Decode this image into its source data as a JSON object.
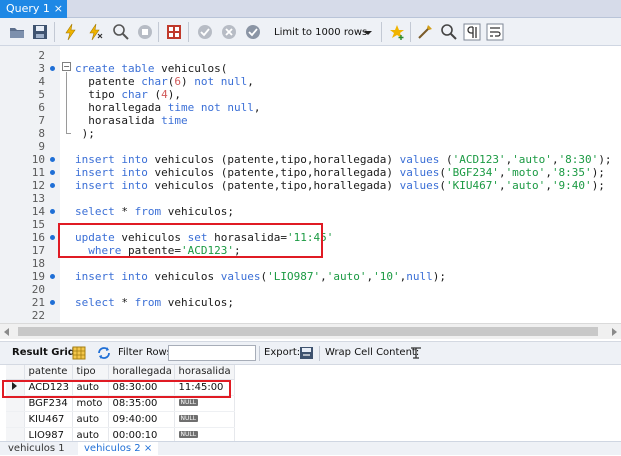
{
  "tab": {
    "title": "Query 1",
    "close": "×"
  },
  "toolbar": {
    "limit_label": "Limit to 1000 rows"
  },
  "editor": {
    "lines": [
      {
        "n": "2",
        "dot": false,
        "code": ""
      },
      {
        "n": "3",
        "dot": true,
        "code": "create table vehiculos("
      },
      {
        "n": "4",
        "dot": false,
        "code": "  patente char(6) not null,"
      },
      {
        "n": "5",
        "dot": false,
        "code": "  tipo char (4),"
      },
      {
        "n": "6",
        "dot": false,
        "code": "  horallegada time not null,"
      },
      {
        "n": "7",
        "dot": false,
        "code": "  horasalida time"
      },
      {
        "n": "8",
        "dot": false,
        "code": " );"
      },
      {
        "n": "9",
        "dot": false,
        "code": ""
      },
      {
        "n": "10",
        "dot": true,
        "code": "insert into vehiculos (patente,tipo,horallegada) values ('ACD123','auto','8:30');"
      },
      {
        "n": "11",
        "dot": true,
        "code": "insert into vehiculos (patente,tipo,horallegada) values('BGF234','moto','8:35');"
      },
      {
        "n": "12",
        "dot": true,
        "code": "insert into vehiculos (patente,tipo,horallegada) values('KIU467','auto','9:40');"
      },
      {
        "n": "13",
        "dot": false,
        "code": ""
      },
      {
        "n": "14",
        "dot": true,
        "code": "select * from vehiculos;"
      },
      {
        "n": "15",
        "dot": false,
        "code": ""
      },
      {
        "n": "16",
        "dot": true,
        "code": "update vehiculos set horasalida='11:45'"
      },
      {
        "n": "17",
        "dot": false,
        "code": "  where patente='ACD123';"
      },
      {
        "n": "18",
        "dot": false,
        "code": ""
      },
      {
        "n": "19",
        "dot": true,
        "code": "insert into vehiculos values('LIO987','auto','10',null);"
      },
      {
        "n": "20",
        "dot": false,
        "code": ""
      },
      {
        "n": "21",
        "dot": true,
        "code": "select * from vehiculos;"
      },
      {
        "n": "22",
        "dot": false,
        "code": ""
      }
    ]
  },
  "result_toolbar": {
    "result_grid": "Result Grid",
    "filter_rows": "Filter Rows:",
    "filter_value": "",
    "export": "Export:",
    "wrap": "Wrap Cell Content:"
  },
  "grid": {
    "columns": [
      "patente",
      "tipo",
      "horallegada",
      "horasalida"
    ],
    "rows": [
      [
        "ACD123",
        "auto",
        "08:30:00",
        "11:45:00"
      ],
      [
        "BGF234",
        "moto",
        "08:35:00",
        "NULL"
      ],
      [
        "KIU467",
        "auto",
        "09:40:00",
        "NULL"
      ],
      [
        "LIO987",
        "auto",
        "00:00:10",
        "NULL"
      ]
    ]
  },
  "bottom_tabs": {
    "tab1": "vehiculos 1",
    "tab2": "vehiculos 2",
    "close": "×"
  },
  "colors": {
    "keyword": "#3b6fd6",
    "string": "#1b9a43",
    "number": "#d15a5a",
    "highlight": "#e01b24",
    "tab_active": "#1e88e5"
  }
}
